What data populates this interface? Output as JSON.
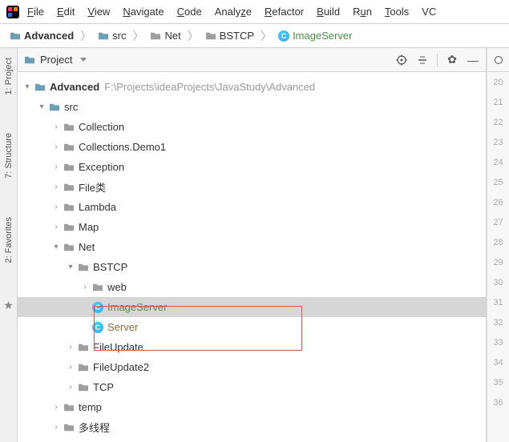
{
  "menubar": {
    "items": [
      "File",
      "Edit",
      "View",
      "Navigate",
      "Code",
      "Analyze",
      "Refactor",
      "Build",
      "Run",
      "Tools",
      "VC"
    ]
  },
  "breadcrumb": {
    "root": "Advanced",
    "segs": [
      "src",
      "Net",
      "BSTCP",
      "ImageServer"
    ]
  },
  "panel": {
    "title": "Project"
  },
  "sidetabs": {
    "project": "1: Project",
    "structure": "7: Structure",
    "favorites": "2: Favorites"
  },
  "tree": {
    "root": {
      "label": "Advanced",
      "path": "F:\\Projects\\ideaProjects\\JavaStudy\\Advanced"
    },
    "src": "src",
    "packages": [
      "Collection",
      "Collections.Demo1",
      "Exception",
      "File类",
      "Lambda",
      "Map"
    ],
    "net": "Net",
    "bstcp": "BSTCP",
    "web": "web",
    "imageServer": "ImageServer",
    "server": "Server",
    "fileUpdate": "FileUpdate",
    "fileUpdate2": "FileUpdate2",
    "tcp": "TCP",
    "temp": "temp",
    "thread": "多线程"
  },
  "gutter": {
    "start": 20,
    "lines": [
      20,
      21,
      22,
      23,
      24,
      25,
      26,
      27,
      28,
      29,
      30,
      31,
      32,
      33,
      34,
      35,
      36
    ]
  }
}
